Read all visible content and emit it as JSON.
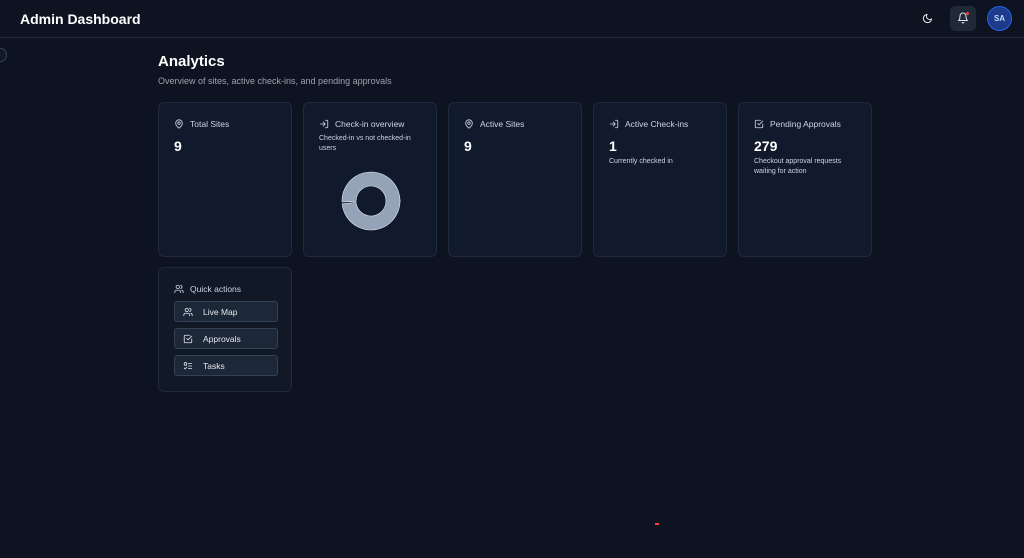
{
  "app": {
    "title": "Admin Dashboard"
  },
  "header": {
    "theme_icon": "moon-icon",
    "notification_icon": "bell-icon",
    "avatar_initials": "SA"
  },
  "page": {
    "title": "Analytics",
    "subtitle": "Overview of sites, active check-ins, and pending approvals"
  },
  "cards": {
    "total_sites": {
      "icon": "map-pin-icon",
      "label": "Total Sites",
      "value": "9"
    },
    "checkin_overview": {
      "icon": "login-icon",
      "label": "Check-in overview",
      "description": "Checked-in vs not checked-in users",
      "chart_data": {
        "type": "pie",
        "categories": [
          "Checked-in",
          "Not checked-in"
        ],
        "values": [
          1,
          99
        ],
        "colors": [
          "#86efac",
          "#94a3b8"
        ]
      }
    },
    "active_sites": {
      "icon": "map-pin-icon",
      "label": "Active Sites",
      "value": "9"
    },
    "active_checkins": {
      "icon": "login-icon",
      "label": "Active Check-ins",
      "value": "1",
      "description": "Currently checked in"
    },
    "pending_approvals": {
      "icon": "checkbox-icon",
      "label": "Pending Approvals",
      "value": "279",
      "description": "Checkout approval requests waiting for action"
    }
  },
  "quick_actions": {
    "icon": "users-icon",
    "label": "Quick actions",
    "items": [
      {
        "icon": "users-icon",
        "label": "Live Map"
      },
      {
        "icon": "checkbox-icon",
        "label": "Approvals"
      },
      {
        "icon": "list-checks-icon",
        "label": "Tasks"
      }
    ]
  },
  "colors": {
    "background": "#0d1320",
    "card": "#111a2c",
    "accent": "#2563eb",
    "notification_dot": "#ef4444"
  }
}
